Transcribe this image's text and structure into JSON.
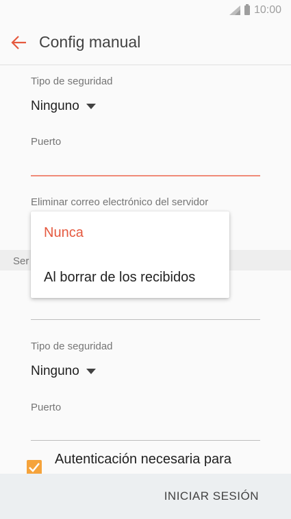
{
  "status": {
    "time": "10:00"
  },
  "appbar": {
    "title": "Config manual"
  },
  "incoming": {
    "security_label": "Tipo de seguridad",
    "security_value": "Ninguno",
    "port_label": "Puerto",
    "port_value": "",
    "delete_label": "Eliminar correo electrónico del servidor"
  },
  "popup": {
    "options": [
      "Nunca",
      "Al borrar de los recibidos"
    ],
    "selected": "Nunca"
  },
  "outgoing": {
    "section_partial": "Ser",
    "security_label": "Tipo de seguridad",
    "security_value": "Ninguno",
    "port_label": "Puerto",
    "port_value": ""
  },
  "auth": {
    "label": "Autenticación necesaria para",
    "checked": true
  },
  "bottom": {
    "login_label": "INICIAR SESIÓN"
  },
  "colors": {
    "accent": "#e5593f",
    "checkbox": "#f5a33b",
    "active_underline": "#f08a78"
  }
}
